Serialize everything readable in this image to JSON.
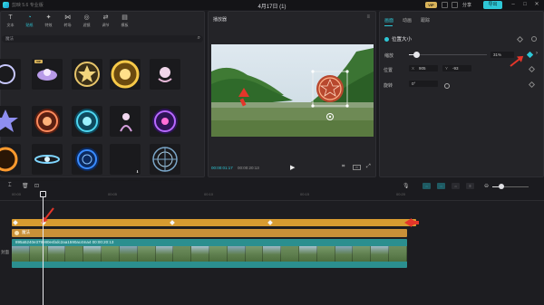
{
  "window": {
    "app_title": "剪映 5.6 专业版",
    "project_title": "4月17日 (1)",
    "vip_label": "VIP",
    "share_label": "分享",
    "export_label": "导出"
  },
  "media": {
    "tabs": [
      {
        "label": "文本",
        "icon": "text-icon"
      },
      {
        "label": "贴纸",
        "icon": "sticker-icon"
      },
      {
        "label": "特效",
        "icon": "effects-icon"
      },
      {
        "label": "转场",
        "icon": "transition-icon"
      },
      {
        "label": "滤镜",
        "icon": "filter-icon"
      },
      {
        "label": "调节",
        "icon": "adjust-icon"
      },
      {
        "label": "模板",
        "icon": "template-icon"
      }
    ],
    "active_tab": 1,
    "category_label": "魔法",
    "vip_badge": "VIP"
  },
  "player": {
    "title": "播放器",
    "current_time": "00:00:01:17",
    "total_time": "00:00:20:13"
  },
  "properties": {
    "tabs": [
      "画面",
      "动画",
      "跟踪"
    ],
    "active_tab": 0,
    "section_title": "位置大小",
    "scale_label": "缩放",
    "scale_value": "31%",
    "scale_fraction": 0.31,
    "position_label": "位置",
    "pos_x_key": "X",
    "pos_x_value": "905",
    "pos_y_key": "Y",
    "pos_y_value": "-93",
    "rotate_label": "旋转",
    "rotate_value": "0°"
  },
  "timeline": {
    "ruler_ticks": [
      "00:00",
      "00:05",
      "00:10",
      "00:15",
      "00:20"
    ],
    "sticker_clip_label": "魔法",
    "video_clip_name": "895a5240e379e80e4bdc2aa1590ac4ma4   00:00:20:13",
    "track_label": "封面"
  },
  "colors": {
    "accent": "#2ec7d6",
    "sticker_clip": "#d79b30",
    "video_clip": "#2b8f8f",
    "annotation_arrow": "#e4362a"
  }
}
